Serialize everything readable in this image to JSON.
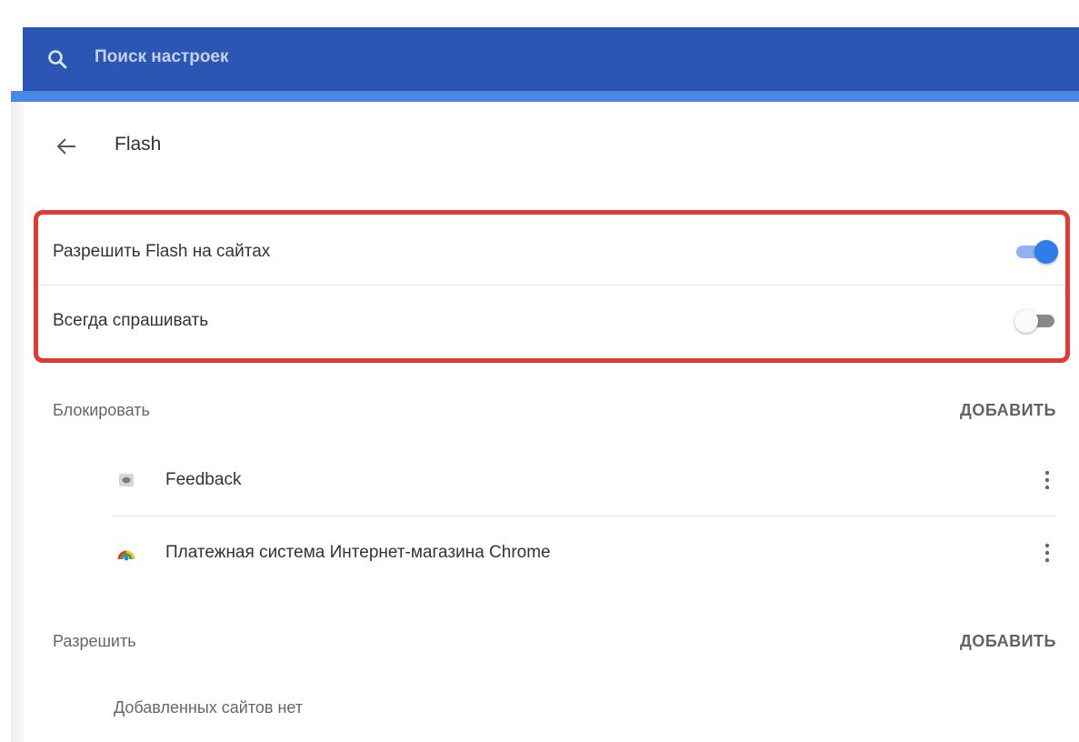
{
  "search": {
    "placeholder": "Поиск настроек"
  },
  "header": {
    "title": "Flash"
  },
  "settings": {
    "allow_flash": {
      "label": "Разрешить Flash на сайтах",
      "enabled": true
    },
    "always_ask": {
      "label": "Всегда спрашивать",
      "enabled": false
    }
  },
  "block": {
    "label": "Блокировать",
    "add_label": "ДОБАВИТЬ",
    "sites": [
      {
        "name": "Feedback",
        "icon": "feedback-icon"
      },
      {
        "name": "Платежная система Интернет-магазина Chrome",
        "icon": "chrome-webstore-icon"
      }
    ]
  },
  "allow": {
    "label": "Разрешить",
    "add_label": "ДОБАВИТЬ",
    "empty_text": "Добавленных сайтов нет"
  },
  "colors": {
    "search_bar": "#2c56b3",
    "accent_blue": "#2f7ce9",
    "highlight_red": "#e03b33"
  }
}
